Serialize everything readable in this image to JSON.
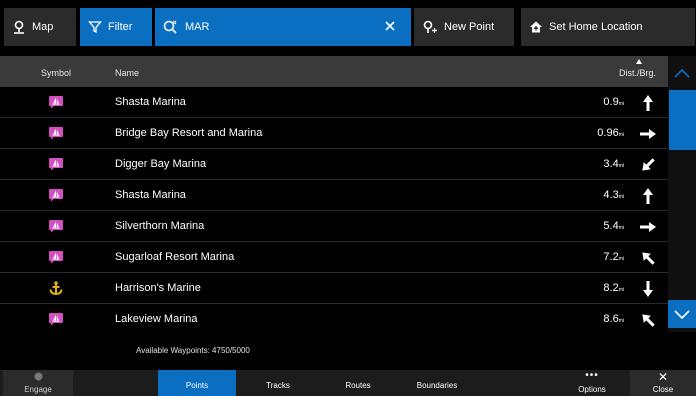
{
  "toolbar": {
    "map_label": "Map",
    "filter_label": "Filter",
    "search_value": "MAR",
    "new_point_label": "New Point",
    "set_home_label": "Set Home Location"
  },
  "columns": {
    "symbol": "Symbol",
    "name": "Name",
    "dist": "Dist./Brg."
  },
  "rows": [
    {
      "icon": "marina-icon",
      "name": "Shasta Marina",
      "dist": "0.9",
      "unit": "mi",
      "bearing": "north"
    },
    {
      "icon": "marina-icon",
      "name": "Bridge Bay Resort and Marina",
      "dist": "0.96",
      "unit": "mi",
      "bearing": "east"
    },
    {
      "icon": "marina-icon",
      "name": "Digger Bay Marina",
      "dist": "3.4",
      "unit": "mi",
      "bearing": "southwest"
    },
    {
      "icon": "marina-icon",
      "name": "Shasta Marina",
      "dist": "4.3",
      "unit": "mi",
      "bearing": "north"
    },
    {
      "icon": "marina-icon",
      "name": "Silverthorn Marina",
      "dist": "5.4",
      "unit": "mi",
      "bearing": "east"
    },
    {
      "icon": "marina-icon",
      "name": "Sugarloaf Resort Marina",
      "dist": "7.2",
      "unit": "mi",
      "bearing": "northwest"
    },
    {
      "icon": "anchor-icon",
      "name": "Harrison's Marine",
      "dist": "8.2",
      "unit": "mi",
      "bearing": "south"
    },
    {
      "icon": "marina-icon",
      "name": "Lakeview Marina",
      "dist": "8.6",
      "unit": "mi",
      "bearing": "northwest"
    }
  ],
  "waypoints_text": "Available Waypoints: 4750/5000",
  "bottom": {
    "engage": "Engage",
    "points": "Points",
    "tracks": "Tracks",
    "routes": "Routes",
    "boundaries": "Boundaries",
    "options": "Options",
    "close": "Close"
  },
  "colors": {
    "accent": "#0a6fc0",
    "marina_icon": "#d24fc0",
    "anchor_icon": "#e0b020"
  }
}
